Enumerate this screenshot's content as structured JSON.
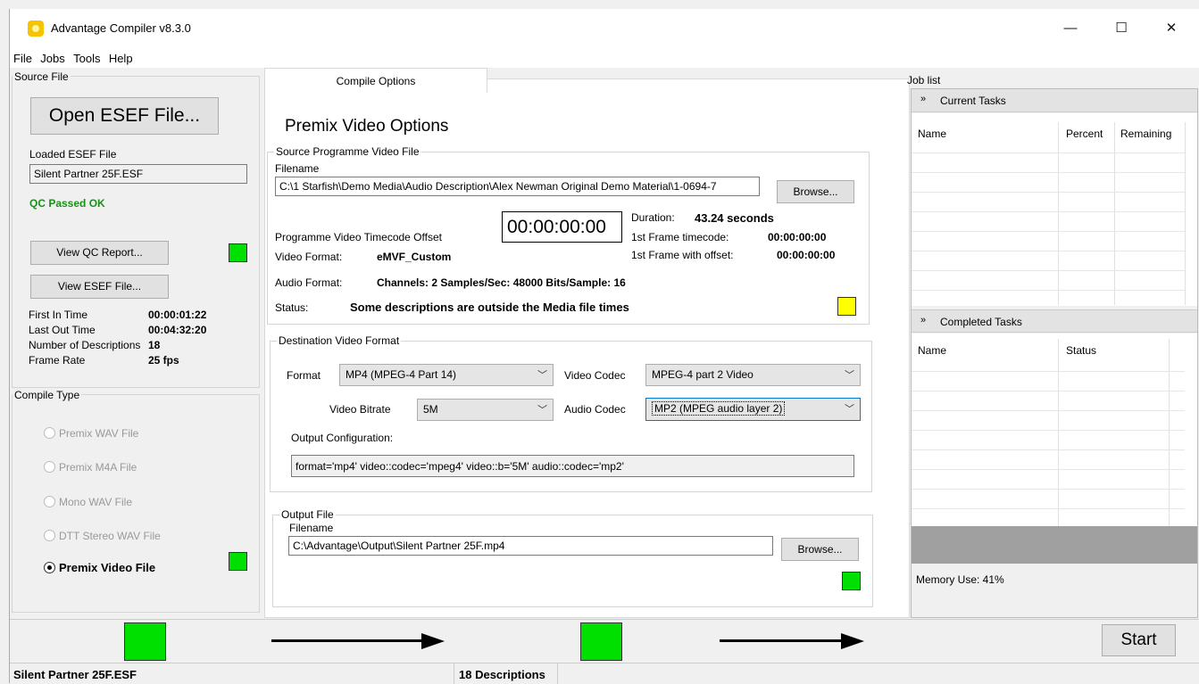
{
  "window": {
    "title": "Advantage Compiler v8.3.0",
    "minimize_glyph": "—",
    "maximize_glyph": "☐",
    "close_glyph": "✕"
  },
  "menu": [
    "File",
    "Jobs",
    "Tools",
    "Help"
  ],
  "source_file": {
    "group_title": "Source File",
    "open_button": "Open ESEF File...",
    "loaded_label": "Loaded ESEF File",
    "loaded_value": "Silent Partner 25F.ESF",
    "qc_status": "QC Passed OK",
    "view_qc_button": "View QC Report...",
    "view_esef_button": "View ESEF File...",
    "stats": [
      {
        "label": "First In Time",
        "value": "00:00:01:22"
      },
      {
        "label": "Last Out Time",
        "value": "00:04:32:20"
      },
      {
        "label": "Number of Descriptions",
        "value": "18"
      },
      {
        "label": "Frame Rate",
        "value": "25 fps"
      }
    ]
  },
  "compile_type": {
    "group_title": "Compile Type",
    "options": [
      {
        "label": "Premix WAV File",
        "selected": false
      },
      {
        "label": "Premix M4A File",
        "selected": false
      },
      {
        "label": "Mono WAV File",
        "selected": false
      },
      {
        "label": "DTT Stereo WAV File",
        "selected": false
      },
      {
        "label": "Premix Video File",
        "selected": true
      }
    ]
  },
  "tabs": {
    "active": "Compile Options"
  },
  "premix": {
    "heading": "Premix Video Options",
    "source": {
      "group_title": "Source Programme Video File",
      "filename_label": "Filename",
      "filename_value": "C:\\1 Starfish\\Demo Media\\Audio Description\\Alex Newman Original Demo Material\\1-0694-7",
      "browse": "Browse...",
      "offset_label": "Programme Video Timecode Offset",
      "offset_value": "00:00:00:00",
      "duration_label": "Duration:",
      "duration_value": "43.24 seconds",
      "first_frame_label": "1st Frame timecode:",
      "first_frame_value": "00:00:00:00",
      "first_frame_offset_label": "1st Frame with offset:",
      "first_frame_offset_value": "00:00:00:00",
      "video_format_label": "Video Format:",
      "video_format_value": "eMVF_Custom",
      "audio_format_label": "Audio Format:",
      "audio_format_value": "Channels: 2 Samples/Sec: 48000 Bits/Sample: 16",
      "status_label": "Status:",
      "status_value": "Some descriptions are outside the Media file times"
    },
    "destination": {
      "group_title": "Destination Video Format",
      "format_label": "Format",
      "format_value": "MP4 (MPEG-4 Part 14)",
      "video_codec_label": "Video Codec",
      "video_codec_value": "MPEG-4 part 2 Video",
      "bitrate_label": "Video Bitrate",
      "bitrate_value": "5M",
      "audio_codec_label": "Audio Codec",
      "audio_codec_value": "MP2 (MPEG audio layer 2)",
      "output_config_label": "Output Configuration:",
      "output_config_value": "format='mp4' video::codec='mpeg4' video::b='5M' audio::codec='mp2'"
    },
    "output": {
      "group_title": "Output File",
      "filename_label": "Filename",
      "filename_value": "C:\\Advantage\\Output\\Silent Partner 25F.mp4",
      "browse": "Browse..."
    }
  },
  "job_list": {
    "group_title": "Job list",
    "current_title": "Current Tasks",
    "current_columns": [
      "Name",
      "Percent",
      "Remaining"
    ],
    "completed_title": "Completed Tasks",
    "completed_columns": [
      "Name",
      "Status"
    ],
    "memory": "Memory Use: 41%"
  },
  "action": {
    "start": "Start"
  },
  "status_bar": {
    "file": "Silent Partner 25F.ESF",
    "descriptions": "18 Descriptions"
  },
  "colors": {
    "ok_green": "#00e000",
    "warn_yellow": "#ffff00",
    "qc_text": "#1a8f1a"
  }
}
